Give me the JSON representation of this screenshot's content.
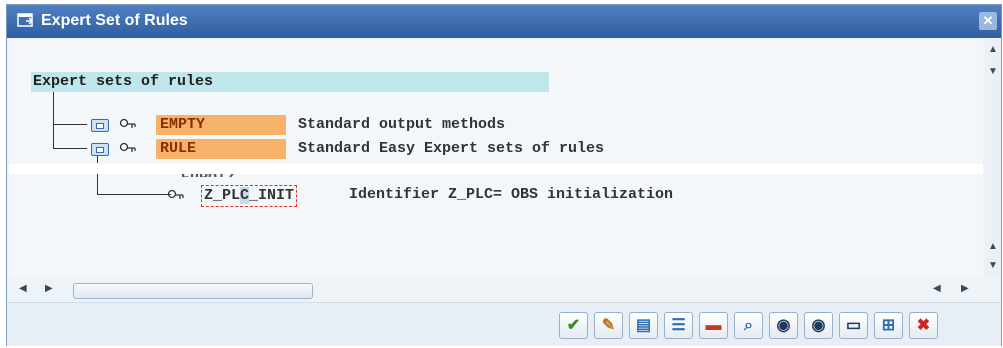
{
  "window": {
    "title": "Expert Set of Rules",
    "close_glyph": "✕"
  },
  "tree": {
    "root_label": "Expert sets of rules",
    "nodes": [
      {
        "code": "EMPTY",
        "description": "Standard output methods",
        "icon": "folder-icon"
      },
      {
        "code": "RULE",
        "description": "Standard Easy Expert sets of rules",
        "icon": "folder-icon"
      }
    ],
    "partial_row_text": "EUROIZ",
    "selected_node": {
      "code": "Z_PLC_INIT",
      "code_prefix": "Z_PL",
      "code_highlight": "C",
      "code_suffix": "_INIT",
      "description": "Identifier Z_PLC= OBS initialization"
    }
  },
  "toolbar": {
    "buttons": [
      {
        "name": "continue-button",
        "icon": "checkmark-icon",
        "glyph": "✔",
        "color": "#3a8a1c"
      },
      {
        "name": "edit-button",
        "icon": "pencil-icon",
        "glyph": "✎",
        "color": "#b7791f"
      },
      {
        "name": "display-button",
        "icon": "display-icon",
        "glyph": "▤",
        "color": "#2f6fb1"
      },
      {
        "name": "document-button",
        "icon": "document-icon",
        "glyph": "☰",
        "color": "#2f6fb1"
      },
      {
        "name": "delete-button",
        "icon": "trash-icon",
        "glyph": "▬",
        "color": "#c0392b"
      },
      {
        "name": "search-button",
        "icon": "magnifier-icon",
        "glyph": "⌕",
        "color": "#2f6fb1"
      },
      {
        "name": "find-button",
        "icon": "binoculars-icon",
        "glyph": "◉",
        "color": "#1f3a5c"
      },
      {
        "name": "find-next-button",
        "icon": "binoculars-next-icon",
        "glyph": "◉",
        "color": "#1f3a5c"
      },
      {
        "name": "print-button",
        "icon": "page-icon",
        "glyph": "▭",
        "color": "#1f3a5c"
      },
      {
        "name": "table-button",
        "icon": "table-icon",
        "glyph": "⊞",
        "color": "#2f6fb1"
      },
      {
        "name": "cancel-button",
        "icon": "cancel-icon",
        "glyph": "✖",
        "color": "#d0261b"
      }
    ]
  },
  "colors": {
    "titlebar": "#2f5f9f",
    "root_highlight": "#bfe6ea",
    "node_code_bg": "#f7b26a",
    "node_code_text": "#8a2e00"
  }
}
